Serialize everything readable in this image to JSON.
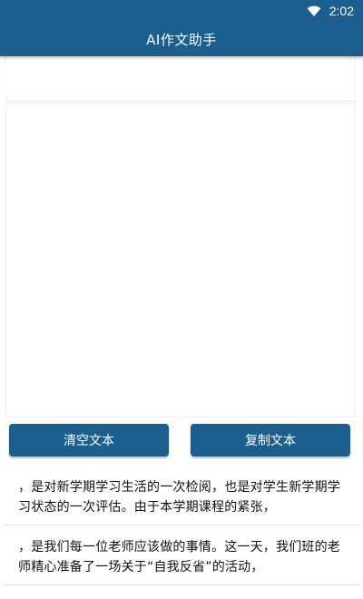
{
  "status_bar": {
    "time": "2:02",
    "icons": [
      "wifi-icon"
    ]
  },
  "app_bar": {
    "title": "AI作文助手"
  },
  "editor": {
    "topic_value": "",
    "content_value": ""
  },
  "actions": {
    "clear_label": "清空文本",
    "copy_label": "复制文本"
  },
  "results": [
    {
      "text": "，是对新学期学习生活的一次检阅，也是对学生新学期学习状态的一次评估。由于本学期课程的紧张，"
    },
    {
      "text": "，是我们每一位老师应该做的事情。这一天，我们班的老师精心准备了一场关于“自我反省”的活动，"
    }
  ],
  "colors": {
    "primary": "#1b5f91",
    "background": "#ffffff",
    "divider": "#e3e3e3"
  }
}
